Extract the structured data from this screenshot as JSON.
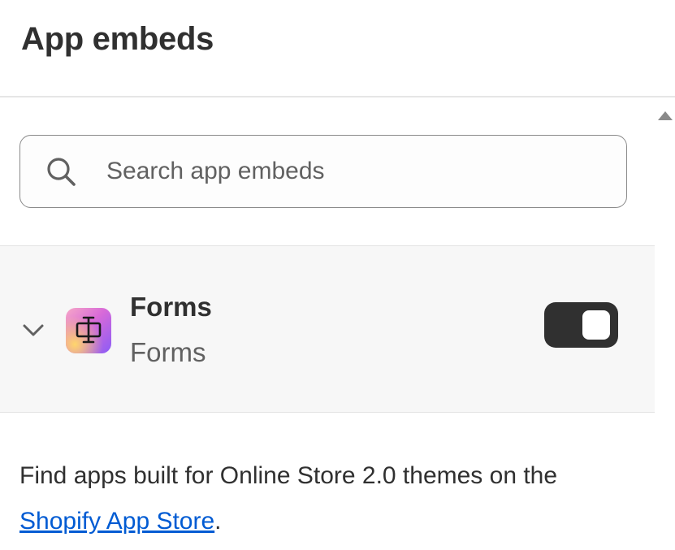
{
  "header": {
    "title": "App embeds"
  },
  "search": {
    "placeholder": "Search app embeds",
    "value": "",
    "icon": "search-icon"
  },
  "embeds": [
    {
      "name": "Forms",
      "subtitle": "Forms",
      "icon": "forms-app-icon",
      "enabled": true,
      "expanded": false
    }
  ],
  "footer": {
    "text_before": "Find apps built for Online Store 2.0 themes on the ",
    "link_label": "Shopify App Store",
    "text_after": "."
  },
  "colors": {
    "toggle_on": "#303030",
    "link": "#005bd3",
    "row_background": "#f7f7f7"
  }
}
